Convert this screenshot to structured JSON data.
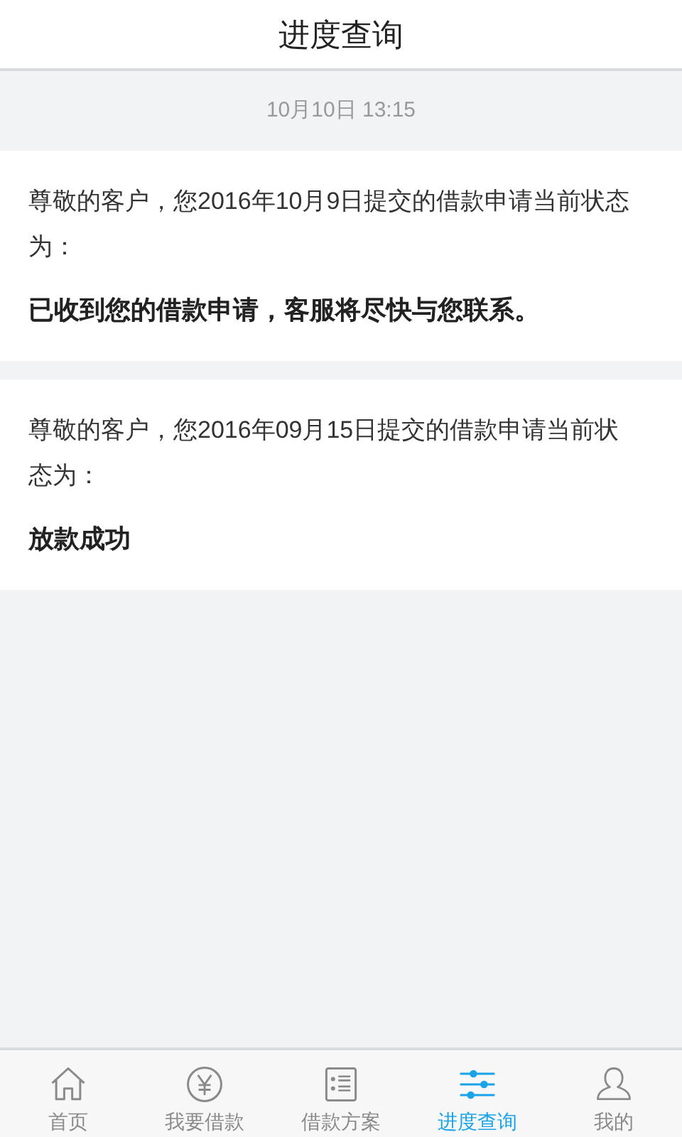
{
  "header": {
    "title": "进度查询"
  },
  "timestamp": "10月10日 13:15",
  "records": [
    {
      "message": "尊敬的客户，您2016年10月9日提交的借款申请当前状态为：",
      "status": "已收到您的借款申请，客服将尽快与您联系。"
    },
    {
      "message": "尊敬的客户，您2016年09月15日提交的借款申请当前状态为：",
      "status": "放款成功"
    }
  ],
  "tabs": [
    {
      "label": "首页",
      "kind": "home",
      "selected": false
    },
    {
      "label": "我要借款",
      "kind": "loan",
      "selected": false
    },
    {
      "label": "借款方案",
      "kind": "plan",
      "selected": false
    },
    {
      "label": "进度查询",
      "kind": "progress",
      "selected": true
    },
    {
      "label": "我的",
      "kind": "profile",
      "selected": false
    }
  ]
}
